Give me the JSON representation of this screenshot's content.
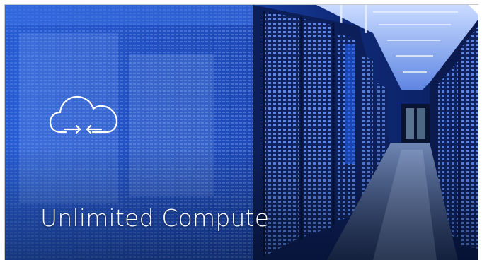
{
  "tile": {
    "title": "Unlimited Compute",
    "icon": "cloud-sync-icon",
    "image": "datacenter-server-aisle",
    "colors": {
      "overlay_blue": "#1f4fbf",
      "deep_blue": "#0a1a4a",
      "text": "#ffffff"
    }
  }
}
